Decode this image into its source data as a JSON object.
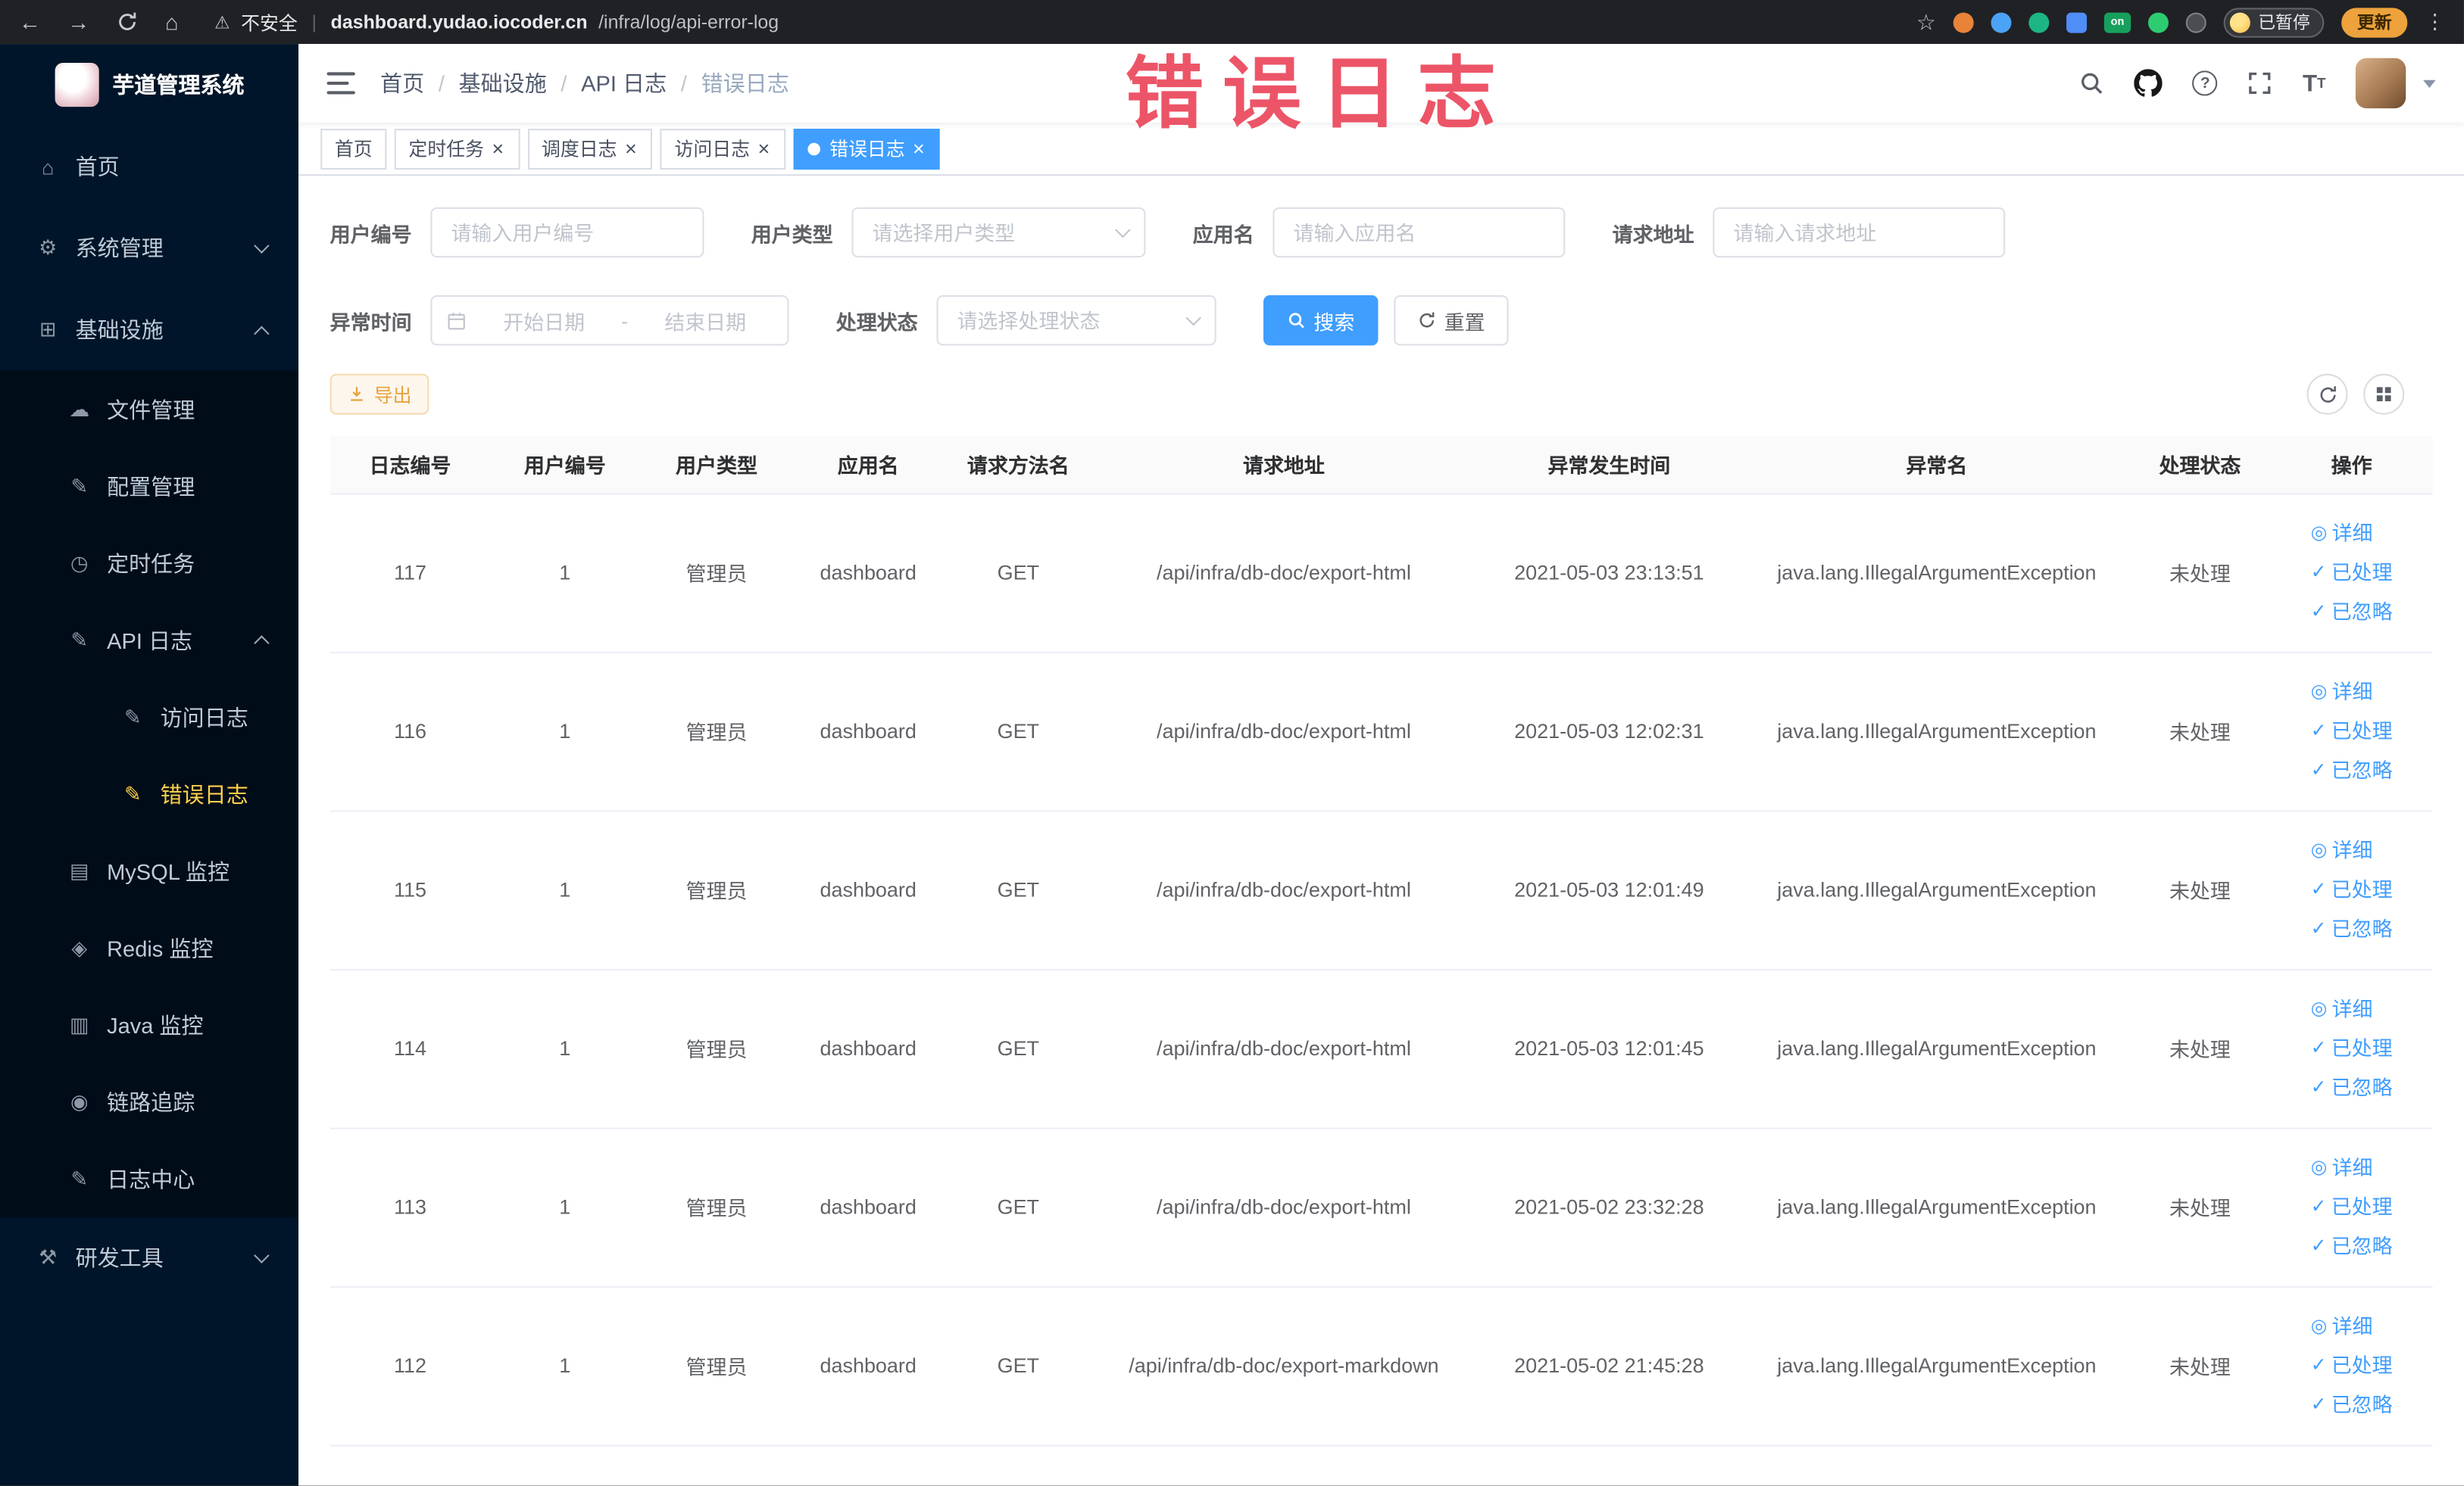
{
  "watermark": "错误日志",
  "browser": {
    "security_label": "不安全",
    "url_host": "dashboard.yudao.iocoder.cn",
    "url_path": "/infra/log/api-error-log",
    "extension_on_badge": "on",
    "paused_badge": "已暂停",
    "update_label": "更新"
  },
  "sidebar": {
    "logo_title": "芋道管理系统",
    "menu": [
      {
        "name": "home",
        "label": "首页",
        "icon": "home-icon",
        "level": 1
      },
      {
        "name": "system-mgmt",
        "label": "系统管理",
        "icon": "gear-icon",
        "level": 1,
        "arrow": "down"
      },
      {
        "name": "infrastructure",
        "label": "基础设施",
        "icon": "infra-icon",
        "level": 1,
        "arrow": "up"
      },
      {
        "name": "file-mgmt",
        "label": "文件管理",
        "icon": "cloud-icon",
        "level": 2,
        "sub": true
      },
      {
        "name": "config-mgmt",
        "label": "配置管理",
        "icon": "edit-icon",
        "level": 2,
        "sub": true
      },
      {
        "name": "scheduled-tasks",
        "label": "定时任务",
        "icon": "timer-icon",
        "level": 2,
        "sub": true
      },
      {
        "name": "api-log",
        "label": "API 日志",
        "icon": "log-icon",
        "level": 2,
        "sub": true,
        "arrow": "up"
      },
      {
        "name": "access-log",
        "label": "访问日志",
        "icon": "doc-icon",
        "level": 3,
        "sub": true
      },
      {
        "name": "error-log",
        "label": "错误日志",
        "icon": "doc-icon",
        "level": 3,
        "sub": true,
        "active": true
      },
      {
        "name": "mysql-monitor",
        "label": "MySQL 监控",
        "icon": "mysql-icon",
        "level": 2,
        "sub": true
      },
      {
        "name": "redis-monitor",
        "label": "Redis 监控",
        "icon": "redis-icon",
        "level": 2,
        "sub": true
      },
      {
        "name": "java-monitor",
        "label": "Java 监控",
        "icon": "java-icon",
        "level": 2,
        "sub": true
      },
      {
        "name": "trace",
        "label": "链路追踪",
        "icon": "trace-icon",
        "level": 2,
        "sub": true
      },
      {
        "name": "log-center",
        "label": "日志中心",
        "icon": "log-center-icon",
        "level": 2,
        "sub": true
      },
      {
        "name": "dev-tools",
        "label": "研发工具",
        "icon": "tools-icon",
        "level": 1,
        "arrow": "down"
      }
    ]
  },
  "header": {
    "breadcrumb": [
      "首页",
      "基础设施",
      "API 日志",
      "错误日志"
    ]
  },
  "tabs": [
    {
      "name": "home",
      "label": "首页",
      "closable": false,
      "active": false
    },
    {
      "name": "scheduled-tasks",
      "label": "定时任务",
      "closable": true,
      "active": false
    },
    {
      "name": "schedule-log",
      "label": "调度日志",
      "closable": true,
      "active": false
    },
    {
      "name": "access-log",
      "label": "访问日志",
      "closable": true,
      "active": false
    },
    {
      "name": "error-log",
      "label": "错误日志",
      "closable": true,
      "active": true
    }
  ],
  "filters": {
    "user_id": {
      "label": "用户编号",
      "placeholder": "请输入用户编号"
    },
    "user_type": {
      "label": "用户类型",
      "placeholder": "请选择用户类型"
    },
    "app_name": {
      "label": "应用名",
      "placeholder": "请输入应用名"
    },
    "request_url": {
      "label": "请求地址",
      "placeholder": "请输入请求地址"
    },
    "exception_time": {
      "label": "异常时间",
      "start_placeholder": "开始日期",
      "separator": "-",
      "end_placeholder": "结束日期"
    },
    "process_status": {
      "label": "处理状态",
      "placeholder": "请选择处理状态"
    },
    "search_label": "搜索",
    "reset_label": "重置"
  },
  "toolbar": {
    "export_label": "导出"
  },
  "table": {
    "columns": [
      "日志编号",
      "用户编号",
      "用户类型",
      "应用名",
      "请求方法名",
      "请求地址",
      "异常发生时间",
      "异常名",
      "处理状态",
      "操作"
    ],
    "actions": {
      "detail": "详细",
      "processed": "已处理",
      "ignored": "已忽略"
    },
    "rows": [
      {
        "id": "117",
        "user_id": "1",
        "user_type": "管理员",
        "app": "dashboard",
        "method": "GET",
        "url": "/api/infra/db-doc/export-html",
        "time": "2021-05-03 23:13:51",
        "exception": "java.lang.IllegalArgumentException",
        "status": "未处理"
      },
      {
        "id": "116",
        "user_id": "1",
        "user_type": "管理员",
        "app": "dashboard",
        "method": "GET",
        "url": "/api/infra/db-doc/export-html",
        "time": "2021-05-03 12:02:31",
        "exception": "java.lang.IllegalArgumentException",
        "status": "未处理"
      },
      {
        "id": "115",
        "user_id": "1",
        "user_type": "管理员",
        "app": "dashboard",
        "method": "GET",
        "url": "/api/infra/db-doc/export-html",
        "time": "2021-05-03 12:01:49",
        "exception": "java.lang.IllegalArgumentException",
        "status": "未处理"
      },
      {
        "id": "114",
        "user_id": "1",
        "user_type": "管理员",
        "app": "dashboard",
        "method": "GET",
        "url": "/api/infra/db-doc/export-html",
        "time": "2021-05-03 12:01:45",
        "exception": "java.lang.IllegalArgumentException",
        "status": "未处理"
      },
      {
        "id": "113",
        "user_id": "1",
        "user_type": "管理员",
        "app": "dashboard",
        "method": "GET",
        "url": "/api/infra/db-doc/export-html",
        "time": "2021-05-02 23:32:28",
        "exception": "java.lang.IllegalArgumentException",
        "status": "未处理"
      },
      {
        "id": "112",
        "user_id": "1",
        "user_type": "管理员",
        "app": "dashboard",
        "method": "GET",
        "url": "/api/infra/db-doc/export-markdown",
        "time": "2021-05-02 21:45:28",
        "exception": "java.lang.IllegalArgumentException",
        "status": "未处理"
      }
    ]
  }
}
